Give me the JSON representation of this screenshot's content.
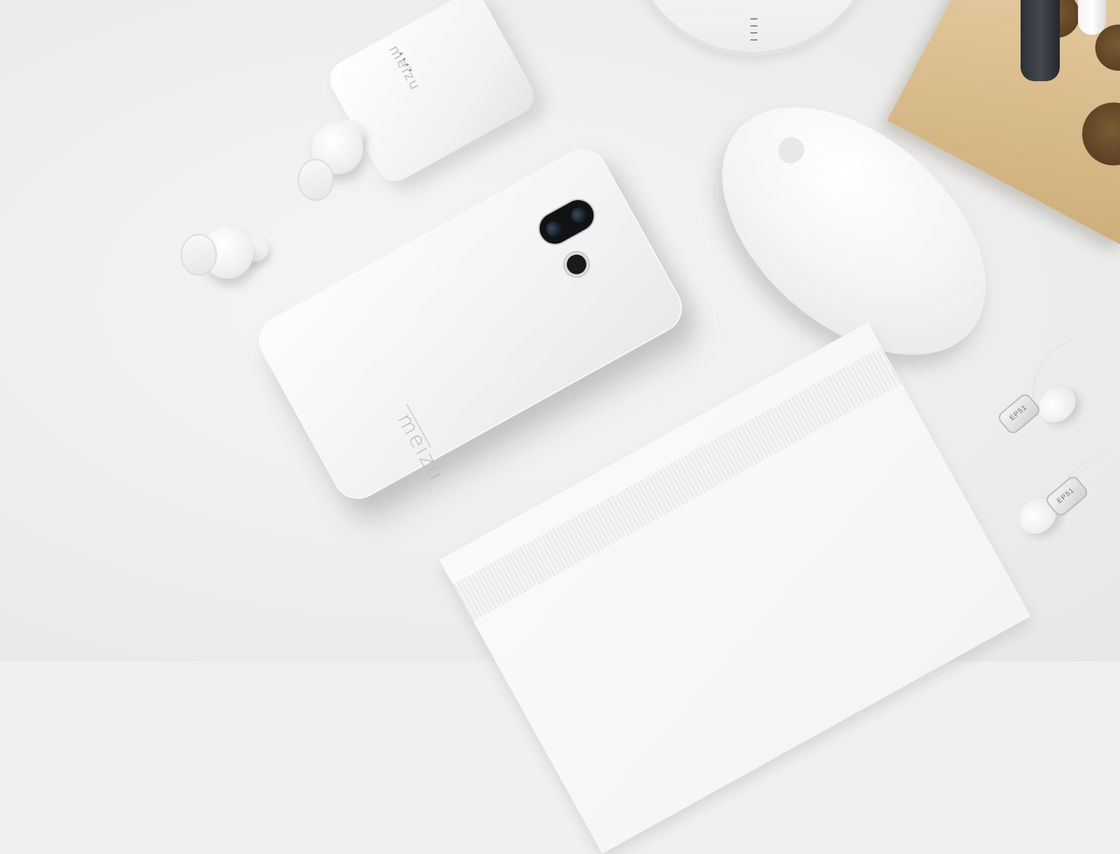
{
  "scene": {
    "description_colors": {
      "background": "#eff0f1",
      "wood": "#d8bb8b",
      "camera": "#111214"
    },
    "phone": {
      "brand_text": "meizu"
    },
    "case": {
      "brand_text": "meizu"
    },
    "earphones": {
      "left_label": "EP51",
      "right_label": "EP51"
    },
    "icons": [
      "apple-logo-icon"
    ]
  }
}
